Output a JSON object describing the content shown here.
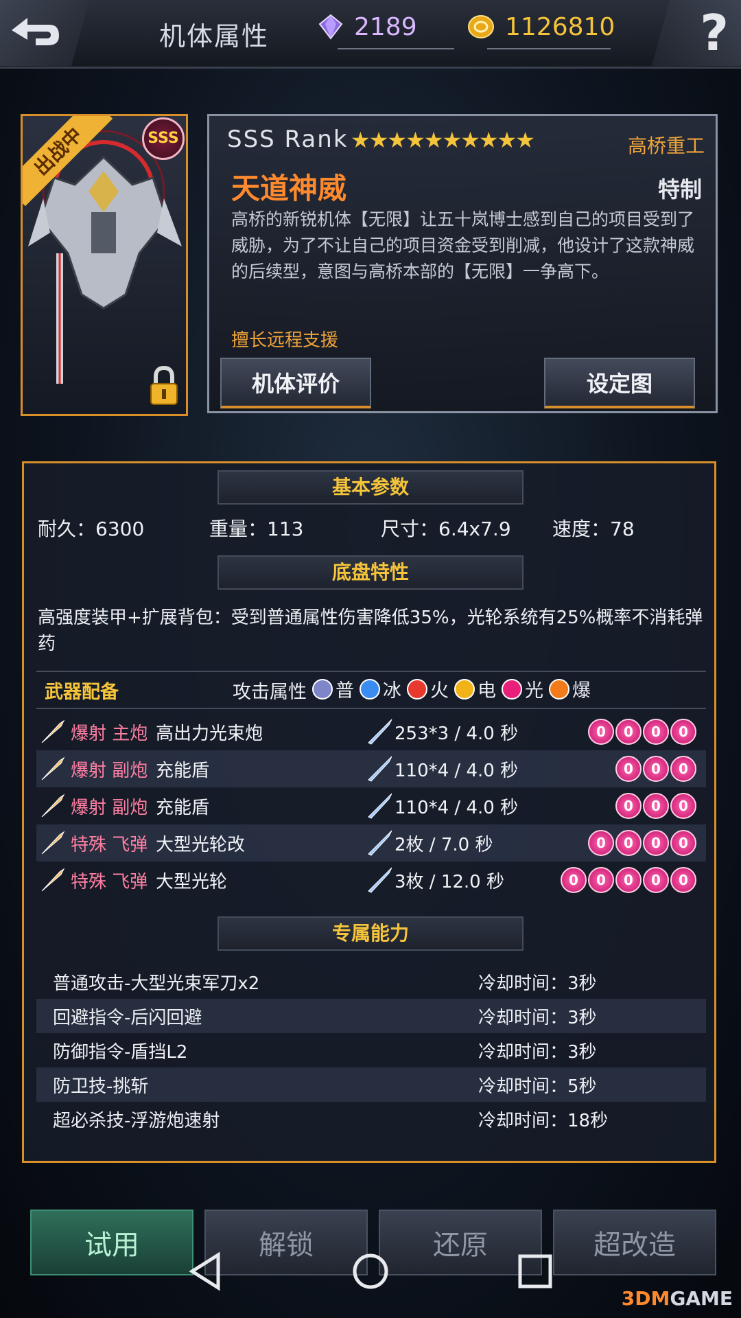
{
  "header": {
    "title": "机体属性",
    "gems": "2189",
    "gold": "1126810",
    "help_label": "?"
  },
  "mech": {
    "banner": "出战中",
    "badge": "SSS",
    "rank": "SSS Rank",
    "stars": "★★★★★★★★★★",
    "star_count": 10,
    "manufacturer": "高桥重工",
    "name": "天道神威",
    "edition": "特制",
    "description": "高桥的新锐机体【无限】让五十岚博士感到自己的项目受到了威胁，为了不让自己的项目资金受到削减，他设计了这款神威的后续型，意图与高桥本部的【无限】一争高下。",
    "specialty": "擅长远程支援",
    "btn_eval": "机体评价",
    "btn_setting": "设定图"
  },
  "basic": {
    "section_title": "基本参数",
    "durability": "耐久：6300",
    "weight": "重量：113",
    "size": "尺寸：6.4x7.9",
    "speed": "速度：78"
  },
  "chassis": {
    "section_title": "底盘特性",
    "text": "高强度装甲+扩展背包：受到普通属性伤害降低35%，光轮系统有25%概率不消耗弹药"
  },
  "weapons": {
    "title": "武器配备",
    "attr_label": "攻击属性",
    "elements": [
      {
        "label": "普",
        "color": "#7e86c9"
      },
      {
        "label": "冰",
        "color": "#3a8cf0"
      },
      {
        "label": "火",
        "color": "#e8392e"
      },
      {
        "label": "电",
        "color": "#f2b318"
      },
      {
        "label": "光",
        "color": "#e8207a"
      },
      {
        "label": "爆",
        "color": "#f27a18"
      }
    ],
    "rows": [
      {
        "type": "爆射 主炮",
        "name": "高出力光束炮",
        "dmg": "253*3 / 4.0 秒",
        "gems": 4
      },
      {
        "type": "爆射 副炮",
        "name": "充能盾",
        "dmg": "110*4 / 4.0 秒",
        "gems": 3
      },
      {
        "type": "爆射 副炮",
        "name": "充能盾",
        "dmg": "110*4 / 4.0 秒",
        "gems": 3
      },
      {
        "type": "特殊 飞弹",
        "name": "大型光轮改",
        "dmg": "2枚 / 7.0 秒",
        "gems": 4
      },
      {
        "type": "特殊 飞弹",
        "name": "大型光轮",
        "dmg": "3枚 / 12.0 秒",
        "gems": 5
      }
    ],
    "gem_glyph": "0"
  },
  "abilities": {
    "section_title": "专属能力",
    "rows": [
      {
        "name": "普通攻击-大型光束军刀x2",
        "cd": "冷却时间：3秒"
      },
      {
        "name": "回避指令-后闪回避",
        "cd": "冷却时间：3秒"
      },
      {
        "name": "防御指令-盾挡L2",
        "cd": "冷却时间：3秒"
      },
      {
        "name": "防卫技-挑斩",
        "cd": "冷却时间：5秒"
      },
      {
        "name": "超必杀技-浮游炮速射",
        "cd": "冷却时间：18秒"
      }
    ]
  },
  "bottom": {
    "trial": "试用",
    "unlock": "解锁",
    "restore": "还原",
    "super": "超改造"
  },
  "watermark": {
    "prefix": "3DM",
    "suffix": "GAME"
  }
}
